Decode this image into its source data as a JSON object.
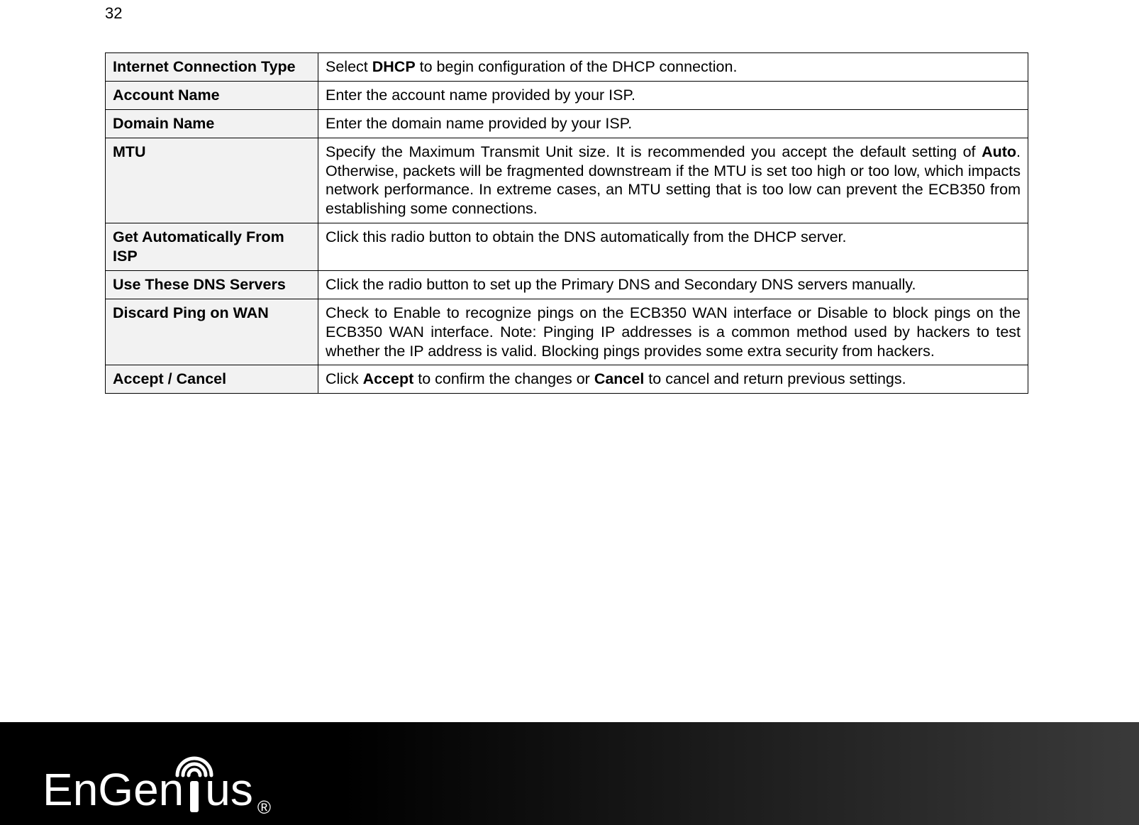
{
  "page_number": "32",
  "brand": {
    "name": "EnGenius",
    "registered": "®"
  },
  "rows": [
    {
      "label": "Internet Connection Type",
      "desc_parts": [
        {
          "t": "Select "
        },
        {
          "t": "DHCP",
          "b": true
        },
        {
          "t": " to begin configuration of the DHCP connection."
        }
      ],
      "justify": false
    },
    {
      "label": "Account Name",
      "desc_parts": [
        {
          "t": "Enter the account name provided by your ISP."
        }
      ],
      "justify": false
    },
    {
      "label": "Domain Name",
      "desc_parts": [
        {
          "t": "Enter the domain name provided by your ISP."
        }
      ],
      "justify": false
    },
    {
      "label": "MTU",
      "desc_parts": [
        {
          "t": "Specify the Maximum Transmit Unit size. It is recommended you accept the default setting of "
        },
        {
          "t": "Auto",
          "b": true
        },
        {
          "t": ". Otherwise, packets will be fragmented downstream if the MTU is set too high or too low, which impacts network performance. In extreme cases, an MTU setting that is too low can prevent the ECB350 from establishing some connections."
        }
      ],
      "justify": true
    },
    {
      "label": "Get Automatically From ISP",
      "desc_parts": [
        {
          "t": "Click this radio button to obtain the DNS automatically from the DHCP server."
        }
      ],
      "justify": false
    },
    {
      "label": "Use These DNS Servers",
      "desc_parts": [
        {
          "t": "Click the radio button to set up the Primary DNS and Secondary DNS servers manually."
        }
      ],
      "justify": false
    },
    {
      "label": "Discard Ping on WAN",
      "desc_parts": [
        {
          "t": "Check to Enable to recognize pings on the ECB350 WAN interface or Disable to block pings on the ECB350 WAN interface. Note: Pinging IP addresses is a common method used by hackers to test whether the IP address is valid. Blocking pings provides some extra security from hackers."
        }
      ],
      "justify": true
    },
    {
      "label": "Accept / Cancel",
      "desc_parts": [
        {
          "t": "Click "
        },
        {
          "t": "Accept",
          "b": true
        },
        {
          "t": " to confirm the changes or "
        },
        {
          "t": "Cancel",
          "b": true
        },
        {
          "t": " to cancel and return previous settings."
        }
      ],
      "justify": false
    }
  ]
}
